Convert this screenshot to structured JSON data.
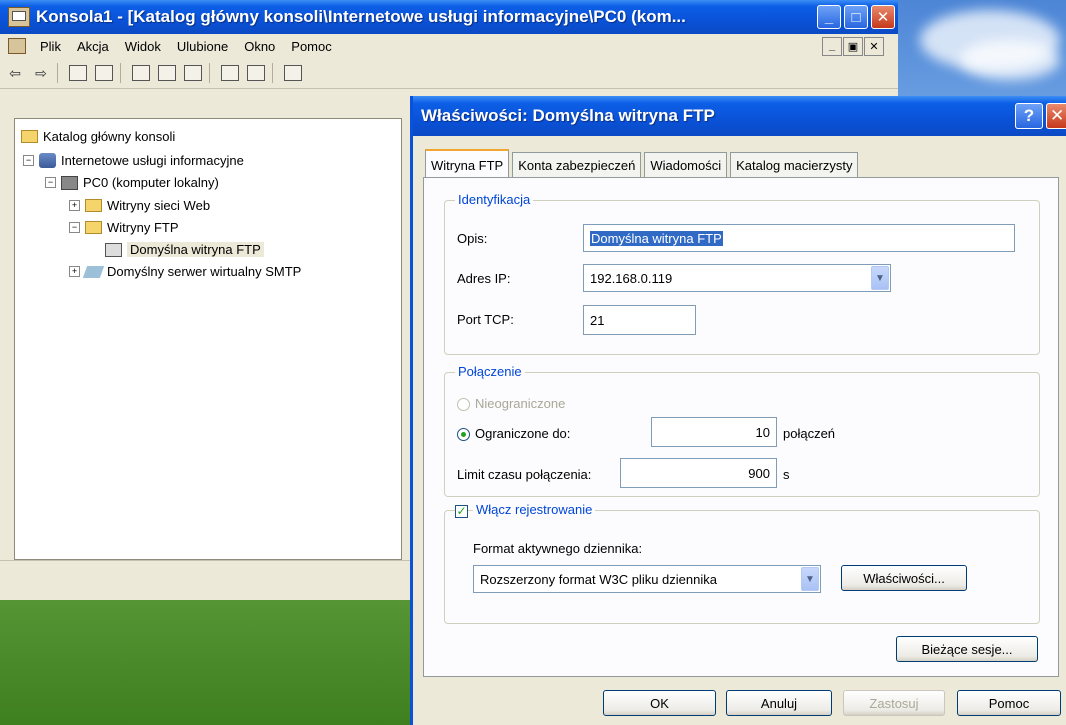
{
  "colors": {
    "xp_blue": "#0a52d8",
    "face": "#ece9d8",
    "group_label": "#0046d5",
    "check_green": "#21a121"
  },
  "mmc": {
    "title": "Konsola1 - [Katalog główny konsoli\\Internetowe usługi informacyjne\\PC0 (kom...",
    "menu": [
      "Plik",
      "Akcja",
      "Widok",
      "Ulubione",
      "Okno",
      "Pomoc"
    ],
    "tree": {
      "root": "Katalog główny konsoli",
      "iis": "Internetowe usługi informacyjne",
      "pc": "PC0 (komputer lokalny)",
      "web_sites": "Witryny sieci Web",
      "ftp_sites": "Witryny FTP",
      "default_ftp": "Domyślna witryna FTP",
      "smtp": "Domyślny serwer wirtualny SMTP"
    }
  },
  "dialog": {
    "title": "Właściwości: Domyślna witryna FTP",
    "tabs": [
      "Witryna FTP",
      "Konta zabezpieczeń",
      "Wiadomości",
      "Katalog macierzysty"
    ],
    "identification": {
      "legend": "Identyfikacja",
      "desc_label": "Opis:",
      "desc_value": "Domyślna witryna FTP",
      "ip_label": "Adres IP:",
      "ip_value": "192.168.0.119",
      "port_label": "Port TCP:",
      "port_value": "21"
    },
    "connection": {
      "legend": "Połączenie",
      "unlimited": "Nieograniczone",
      "limited": "Ograniczone do:",
      "limited_value": "10",
      "limited_unit": "połączeń",
      "timeout_label": "Limit czasu połączenia:",
      "timeout_value": "900",
      "timeout_unit": "s"
    },
    "logging": {
      "enable_label": "Włącz rejestrowanie",
      "format_label": "Format aktywnego dziennika:",
      "format_value": "Rozszerzony format W3C pliku dziennika",
      "properties_button": "Właściwości..."
    },
    "current_sessions_button": "Bieżące sesje...",
    "buttons": {
      "ok": "OK",
      "cancel": "Anuluj",
      "apply": "Zastosuj",
      "help": "Pomoc"
    }
  }
}
